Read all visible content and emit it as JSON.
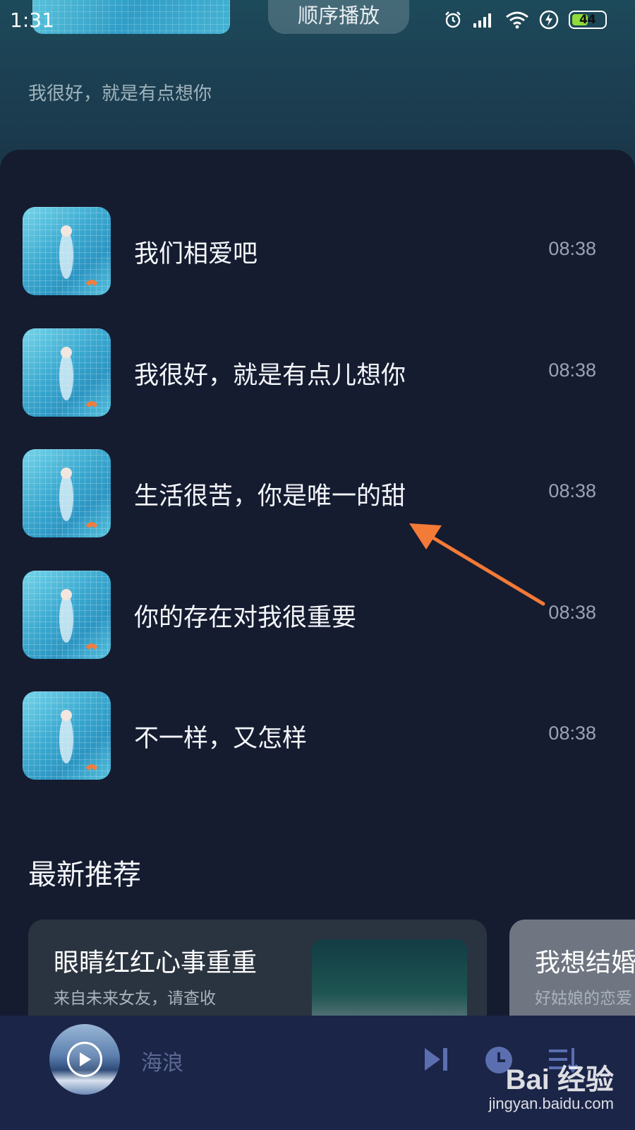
{
  "status_bar": {
    "time": "1:31",
    "battery_level": "44",
    "icons": [
      "alarm-icon",
      "signal-icon",
      "wifi-icon",
      "charging-icon",
      "battery-icon"
    ]
  },
  "header": {
    "play_mode_label": "顺序播放",
    "subtitle": "我很好，就是有点想你"
  },
  "songs": [
    {
      "title": "我们相爱吧",
      "duration": "08:38"
    },
    {
      "title": "我很好，就是有点儿想你",
      "duration": "08:38"
    },
    {
      "title": "生活很苦，你是唯一的甜",
      "duration": "08:38"
    },
    {
      "title": "你的存在对我很重要",
      "duration": "08:38"
    },
    {
      "title": "不一样，又怎样",
      "duration": "08:38"
    }
  ],
  "recommend": {
    "section_title": "最新推荐",
    "cards": [
      {
        "title": "眼睛红红心事重重",
        "subtitle": "来自未来女友，请查收"
      },
      {
        "title": "我想结婚",
        "subtitle": "好姑娘的恋爱"
      }
    ]
  },
  "player": {
    "current_song": "海浪",
    "controls": [
      "play-icon",
      "next-icon",
      "timer-icon",
      "playlist-icon"
    ]
  },
  "watermark": {
    "logo": "Bai 经验",
    "url": "jingyan.baidu.com"
  },
  "colors": {
    "annotation_arrow": "#f47a38",
    "panel_bg": "#151c30",
    "player_bg": "#1b2548",
    "battery_fill": "#8fdc3a"
  }
}
